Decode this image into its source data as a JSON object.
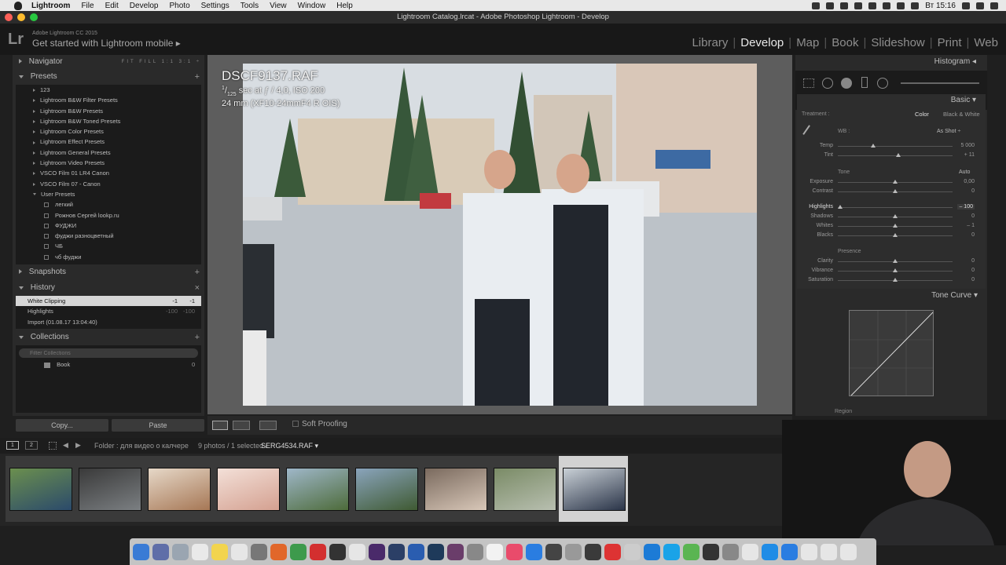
{
  "menubar": {
    "items": [
      "Lightroom",
      "File",
      "Edit",
      "Develop",
      "Photo",
      "Settings",
      "Tools",
      "View",
      "Window",
      "Help"
    ],
    "time": "Вт 15:16"
  },
  "window": {
    "title": "Lightroom Catalog.lrcat - Adobe Photoshop Lightroom - Develop"
  },
  "identity": {
    "logo": "Lr",
    "version": "Adobe Lightroom CC 2015",
    "mobile": "Get started with Lightroom mobile ▸"
  },
  "modules": [
    "Library",
    "Develop",
    "Map",
    "Book",
    "Slideshow",
    "Print",
    "Web"
  ],
  "module_active": "Develop",
  "left": {
    "navigator": {
      "label": "Navigator",
      "zoom": "FIT  FILL  1:1  3:1 ÷"
    },
    "presets": {
      "label": "Presets",
      "items": [
        "123",
        "Lightroom B&W Filter Presets",
        "Lightroom B&W Presets",
        "Lightroom B&W Toned Presets",
        "Lightroom Color Presets",
        "Lightroom Effect Presets",
        "Lightroom General Presets",
        "Lightroom Video Presets",
        "VSCO Film 01 LR4 Canon",
        "VSCO Film 07 - Canon",
        "User Presets"
      ],
      "user_items": [
        "легкий",
        "Рожнов Сергей lookp.ru",
        "ФУДЖИ",
        "фуджи разноцветный",
        "ЧБ",
        "чб фуджи"
      ]
    },
    "snapshots": {
      "label": "Snapshots"
    },
    "history": {
      "label": "History",
      "close": "×",
      "rows": [
        {
          "name": "White Clipping",
          "v1": "-1",
          "v2": "-1"
        },
        {
          "name": "Highlights",
          "v1": "-100",
          "v2": "-100"
        },
        {
          "name": "Import (01.08.17 13:04:40)",
          "v1": "",
          "v2": ""
        }
      ]
    },
    "collections": {
      "label": "Collections",
      "placeholder": "Filter Collections",
      "items": [
        {
          "name": "Book",
          "count": "0"
        }
      ]
    },
    "copy_label": "Copy...",
    "paste_label": "Paste"
  },
  "photo_info": {
    "filename": "DSCF9137.RAF",
    "shutter_num": "1",
    "shutter_den": "125",
    "line1": " sec at ƒ / 4,0, ISO 200",
    "line2": "24 mm (XF10-24mmF4 R OIS)"
  },
  "toolbar": {
    "soft_proofing": "Soft Proofing"
  },
  "right": {
    "histogram": "Histogram ◂",
    "basic": "Basic ▾",
    "treatment": {
      "label": "Treatment :",
      "color": "Color",
      "bw": "Black & White"
    },
    "wb": {
      "label": "WB :",
      "value": "As Shot ÷"
    },
    "wb_sliders": [
      {
        "name": "Temp",
        "value": "5 000",
        "level": 0.31
      },
      {
        "name": "Tint",
        "value": "+ 11",
        "level": 0.53
      }
    ],
    "tone_label": "Tone",
    "auto": "Auto",
    "tone_sliders": [
      {
        "name": "Exposure",
        "value": "0,00",
        "level": 0.5
      },
      {
        "name": "Contrast",
        "value": "0",
        "level": 0.5
      }
    ],
    "tone2_sliders": [
      {
        "name": "Highlights",
        "value": "– 100",
        "level": 0.02
      },
      {
        "name": "Shadows",
        "value": "0",
        "level": 0.5
      },
      {
        "name": "Whites",
        "value": "– 1",
        "level": 0.5
      },
      {
        "name": "Blacks",
        "value": "0",
        "level": 0.5
      }
    ],
    "presence_label": "Presence",
    "presence_sliders": [
      {
        "name": "Clarity",
        "value": "0",
        "level": 0.5
      },
      {
        "name": "Vibrance",
        "value": "0",
        "level": 0.5
      },
      {
        "name": "Saturation",
        "value": "0",
        "level": 0.5
      }
    ],
    "tone_curve": "Tone Curve ▾",
    "region": "Region"
  },
  "filmbar": {
    "page1": "1",
    "page2": "2",
    "folder": "Folder : для видео о калчере",
    "count": "9 photos / 1 selected /",
    "selected_file": "SERG4534.RAF ▾"
  },
  "filmstrip": {
    "count": 9,
    "selected_index": 8,
    "colors": [
      [
        "#6b8f4e",
        "#2b4a6b"
      ],
      [
        "#3a3a3a",
        "#7b7f82"
      ],
      [
        "#e6d8c8",
        "#a67755"
      ],
      [
        "#f3e0d8",
        "#d4a090"
      ],
      [
        "#9fb7c9",
        "#4d6b3a"
      ],
      [
        "#8aa4bc",
        "#3f5a32"
      ],
      [
        "#7a6a5e",
        "#d8c7b8"
      ],
      [
        "#7a8b66",
        "#b8bfb0"
      ],
      [
        "#c9d0d6",
        "#2a3448"
      ]
    ]
  },
  "colors": {
    "bg": "#1f1f1f",
    "panel": "#2a2a2a",
    "accent": "#e8e8e8"
  }
}
